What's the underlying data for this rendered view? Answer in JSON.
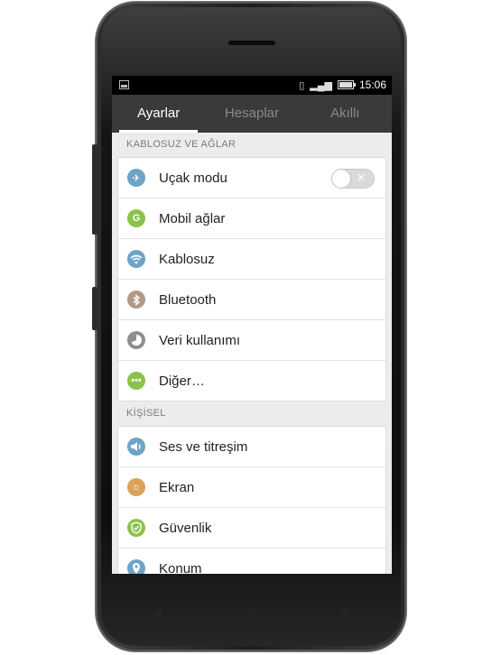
{
  "status_bar": {
    "time": "15:06"
  },
  "tabs": [
    {
      "label": "Ayarlar",
      "active": true
    },
    {
      "label": "Hesaplar",
      "active": false
    },
    {
      "label": "Akıllı",
      "active": false
    }
  ],
  "sections": [
    {
      "header": "KABLOSUZ VE AĞLAR",
      "items": [
        {
          "label": "Uçak modu",
          "icon": "airplane-icon",
          "color": "#6fa3c7",
          "toggle": false
        },
        {
          "label": "Mobil ağlar",
          "icon": "mobile-network-icon",
          "color": "#8bc34a"
        },
        {
          "label": "Kablosuz",
          "icon": "wifi-icon",
          "color": "#6fa3c7"
        },
        {
          "label": "Bluetooth",
          "icon": "bluetooth-icon",
          "color": "#b09a86"
        },
        {
          "label": "Veri kullanımı",
          "icon": "data-usage-icon",
          "color": "#8e8e8e"
        },
        {
          "label": "Diğer…",
          "icon": "more-icon",
          "color": "#8bc34a"
        }
      ]
    },
    {
      "header": "KİŞİSEL",
      "items": [
        {
          "label": "Ses ve titreşim",
          "icon": "sound-icon",
          "color": "#6fa3c7"
        },
        {
          "label": "Ekran",
          "icon": "display-icon",
          "color": "#d9a35a"
        },
        {
          "label": "Güvenlik",
          "icon": "shield-icon",
          "color": "#8bc34a"
        },
        {
          "label": "Konum",
          "icon": "location-icon",
          "color": "#6fa3c7"
        }
      ]
    }
  ]
}
